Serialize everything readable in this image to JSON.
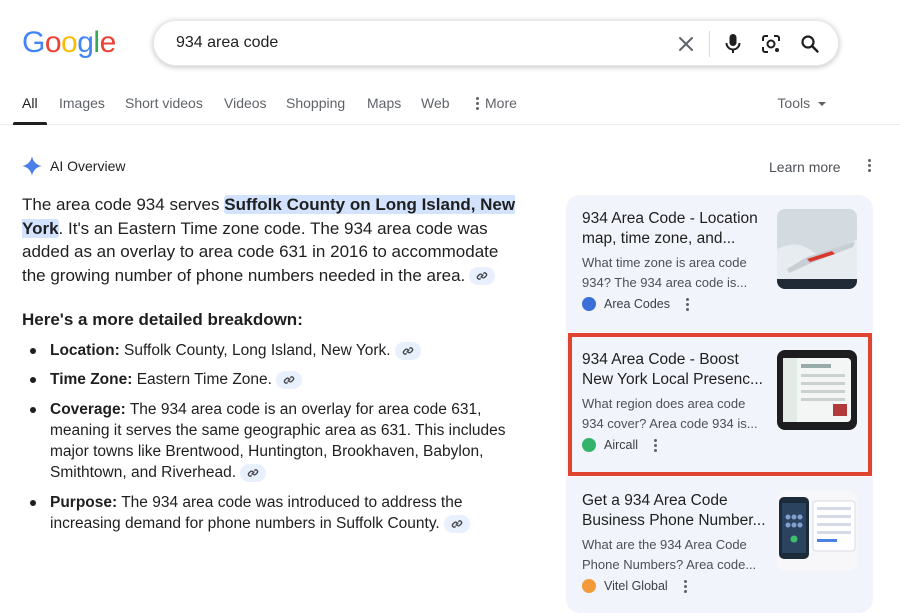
{
  "logo": {
    "letters": [
      "G",
      "o",
      "o",
      "g",
      "l",
      "e"
    ],
    "colors": [
      "#4285F4",
      "#EA4335",
      "#FBBC05",
      "#4285F4",
      "#34A853",
      "#EA4335"
    ]
  },
  "search": {
    "query": "934 area code"
  },
  "tabs": [
    {
      "label": "All",
      "active": true
    },
    {
      "label": "Images"
    },
    {
      "label": "Short videos"
    },
    {
      "label": "Videos"
    },
    {
      "label": "Shopping"
    },
    {
      "label": "Maps"
    },
    {
      "label": "Web"
    },
    {
      "label": "More"
    }
  ],
  "tools_label": "Tools",
  "ai_overview": {
    "title": "AI Overview",
    "learn_more": "Learn more",
    "p1_before": "The area code 934 serves ",
    "p1_highlight": "Suffolk County on Long Island, New York",
    "p1_after": ". It's an Eastern Time zone code. The 934 area code was added as an overlay to area code 631 in 2016 to accommodate the growing number of phone numbers needed in the area.",
    "subheading": "Here's a more detailed breakdown:",
    "bullets": [
      {
        "label": "Location:",
        "text": " Suffolk County, Long Island, New York."
      },
      {
        "label": "Time Zone:",
        "text": " Eastern Time Zone."
      },
      {
        "label": "Coverage:",
        "text": " The 934 area code is an overlay for area code 631, meaning it serves the same geographic area as 631. This includes major towns like Brentwood, Huntington, Brookhaven, Babylon, Smithtown, and Riverhead."
      },
      {
        "label": "Purpose:",
        "text": " The 934 area code was introduced to address the increasing demand for phone numbers in Suffolk County."
      }
    ]
  },
  "sources": [
    {
      "title": "934 Area Code - Location map, time zone, and...",
      "snippet": "What time zone is area code 934? The 934 area code is...",
      "site": "Area Codes",
      "fav_color": "#3b6fd8"
    },
    {
      "title": "934 Area Code - Boost New York Local Presenc...",
      "snippet": "What region does area code 934 cover? Area code 934 is...",
      "site": "Aircall",
      "fav_color": "#34b36b"
    },
    {
      "title": "Get a 934 Area Code Business Phone Number...",
      "snippet": "What are the 934 Area Code Phone Numbers? Area code...",
      "site": "Vitel Global",
      "fav_color": "#f29b38"
    }
  ],
  "highlight_color": "#e0442f"
}
